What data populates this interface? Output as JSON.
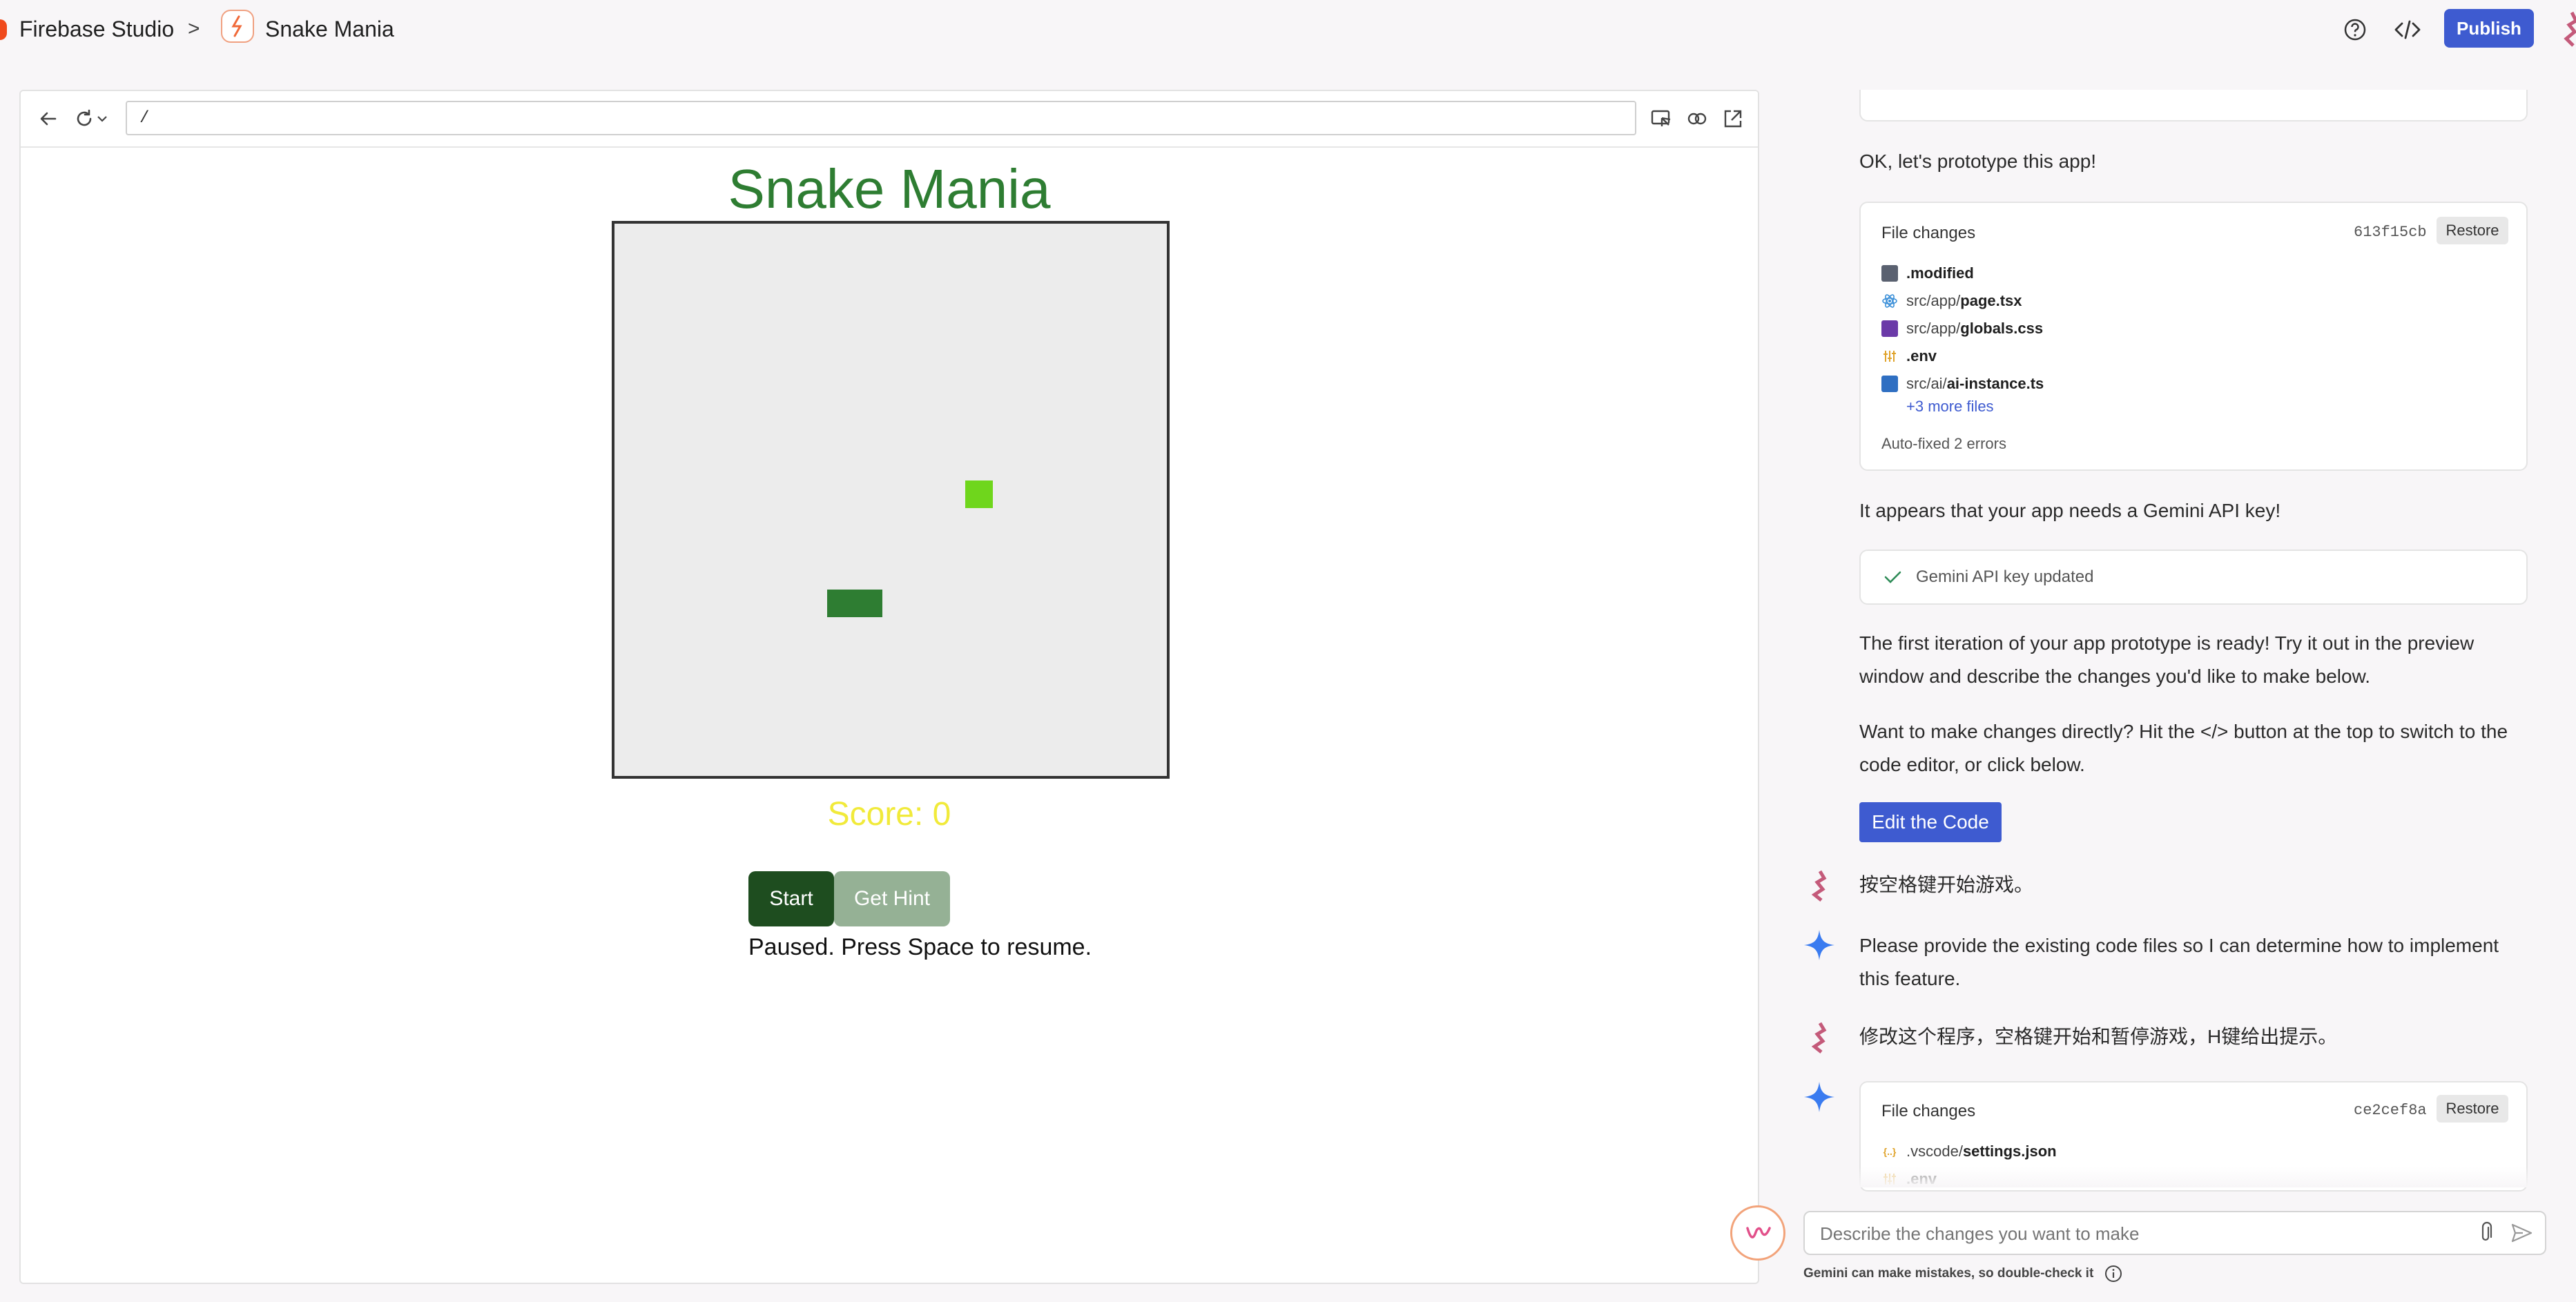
{
  "header": {
    "brand": "Firebase Studio",
    "separator": ">",
    "project_name": "Snake Mania",
    "publish_label": "Publish",
    "icons": [
      "help-icon",
      "code-toggle-icon"
    ]
  },
  "preview": {
    "url": "/",
    "toolbar_icons": [
      "back-icon",
      "reload-icon",
      "chevron-down-icon",
      "inspect-icon",
      "link-icon",
      "open-external-icon"
    ],
    "game": {
      "title": "Snake Mania",
      "score_label": "Score: 0",
      "start_label": "Start",
      "hint_label": "Get Hint",
      "status": "Paused. Press Space to resume."
    }
  },
  "chat": {
    "msg_prototype": "OK, let's prototype this app!",
    "card1": {
      "title": "File changes",
      "hash": "613f15cb",
      "restore_label": "Restore",
      "files": [
        {
          "dir": "",
          "name": ".modified",
          "icon": "file-icon"
        },
        {
          "dir": "src/app/",
          "name": "page.tsx",
          "icon": "react-icon"
        },
        {
          "dir": "src/app/",
          "name": "globals.css",
          "icon": "css-icon"
        },
        {
          "dir": "",
          "name": ".env",
          "icon": "env-icon"
        },
        {
          "dir": "src/ai/",
          "name": "ai-instance.ts",
          "icon": "typescript-icon"
        }
      ],
      "more_files": "+3 more files",
      "autofix": "Auto-fixed 2 errors"
    },
    "msg_api_key": "It appears that your app needs a Gemini API key!",
    "api_key_status": "Gemini API key updated",
    "msg_first_iter": "The first iteration of your app prototype is ready! Try it out in the preview window and describe the changes you'd like to make below.",
    "msg_direct": "Want to make changes directly? Hit the </> button at the top to switch to the code editor, or click below.",
    "edit_code_label": "Edit the Code",
    "user_msg1": "按空格键开始游戏。",
    "ai_msg1": "Please provide the existing code files so I can determine how to implement this feature.",
    "user_msg2": "修改这个程序，空格键开始和暂停游戏，H键给出提示。",
    "card2": {
      "title": "File changes",
      "hash": "ce2cef8a",
      "restore_label": "Restore",
      "files": [
        {
          "dir": ".vscode/",
          "name": "settings.json",
          "icon": "json-icon"
        },
        {
          "dir": "",
          "name": ".env",
          "icon": "env-icon"
        }
      ]
    },
    "input_placeholder": "Describe the changes you want to make",
    "disclaimer": "Gemini can make mistakes, so double-check it"
  },
  "colors": {
    "accent": "#3e5bd0",
    "snake": "#2e7d32",
    "food": "#6fd61c",
    "score": "#f1ea3a",
    "title_green": "#2e7d32"
  }
}
